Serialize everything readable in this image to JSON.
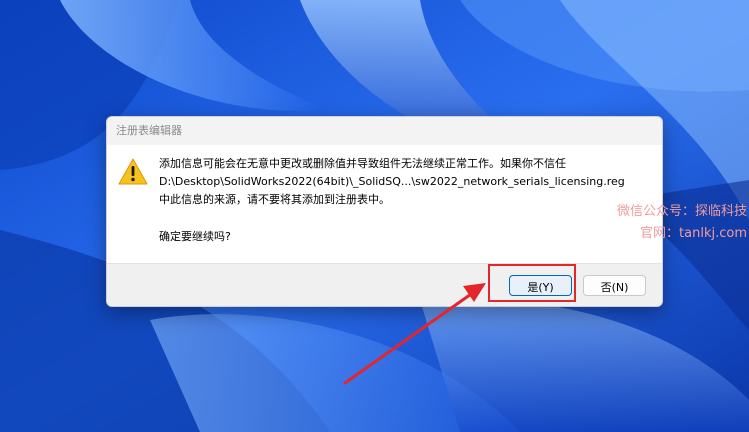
{
  "dialog": {
    "title": "注册表编辑器",
    "message_lines": [
      "添加信息可能会在无意中更改或删除值并导致组件无法继续正常工作。如果你不信任",
      "D:\\Desktop\\SolidWorks2022(64bit)\\_SolidSQ...\\sw2022_network_serials_licensing.reg",
      "中此信息的来源，请不要将其添加到注册表中。"
    ],
    "confirm_question": "确定要继续吗?",
    "yes_label": "是(Y)",
    "no_label": "否(N)",
    "icon": "warning-icon"
  },
  "watermark": {
    "line1": "微信公众号：探临科技",
    "line2": "官网：tanlkj.com"
  },
  "colors": {
    "highlight": "#e3262b",
    "arrow": "#e3262b",
    "accent": "#0067c0"
  }
}
